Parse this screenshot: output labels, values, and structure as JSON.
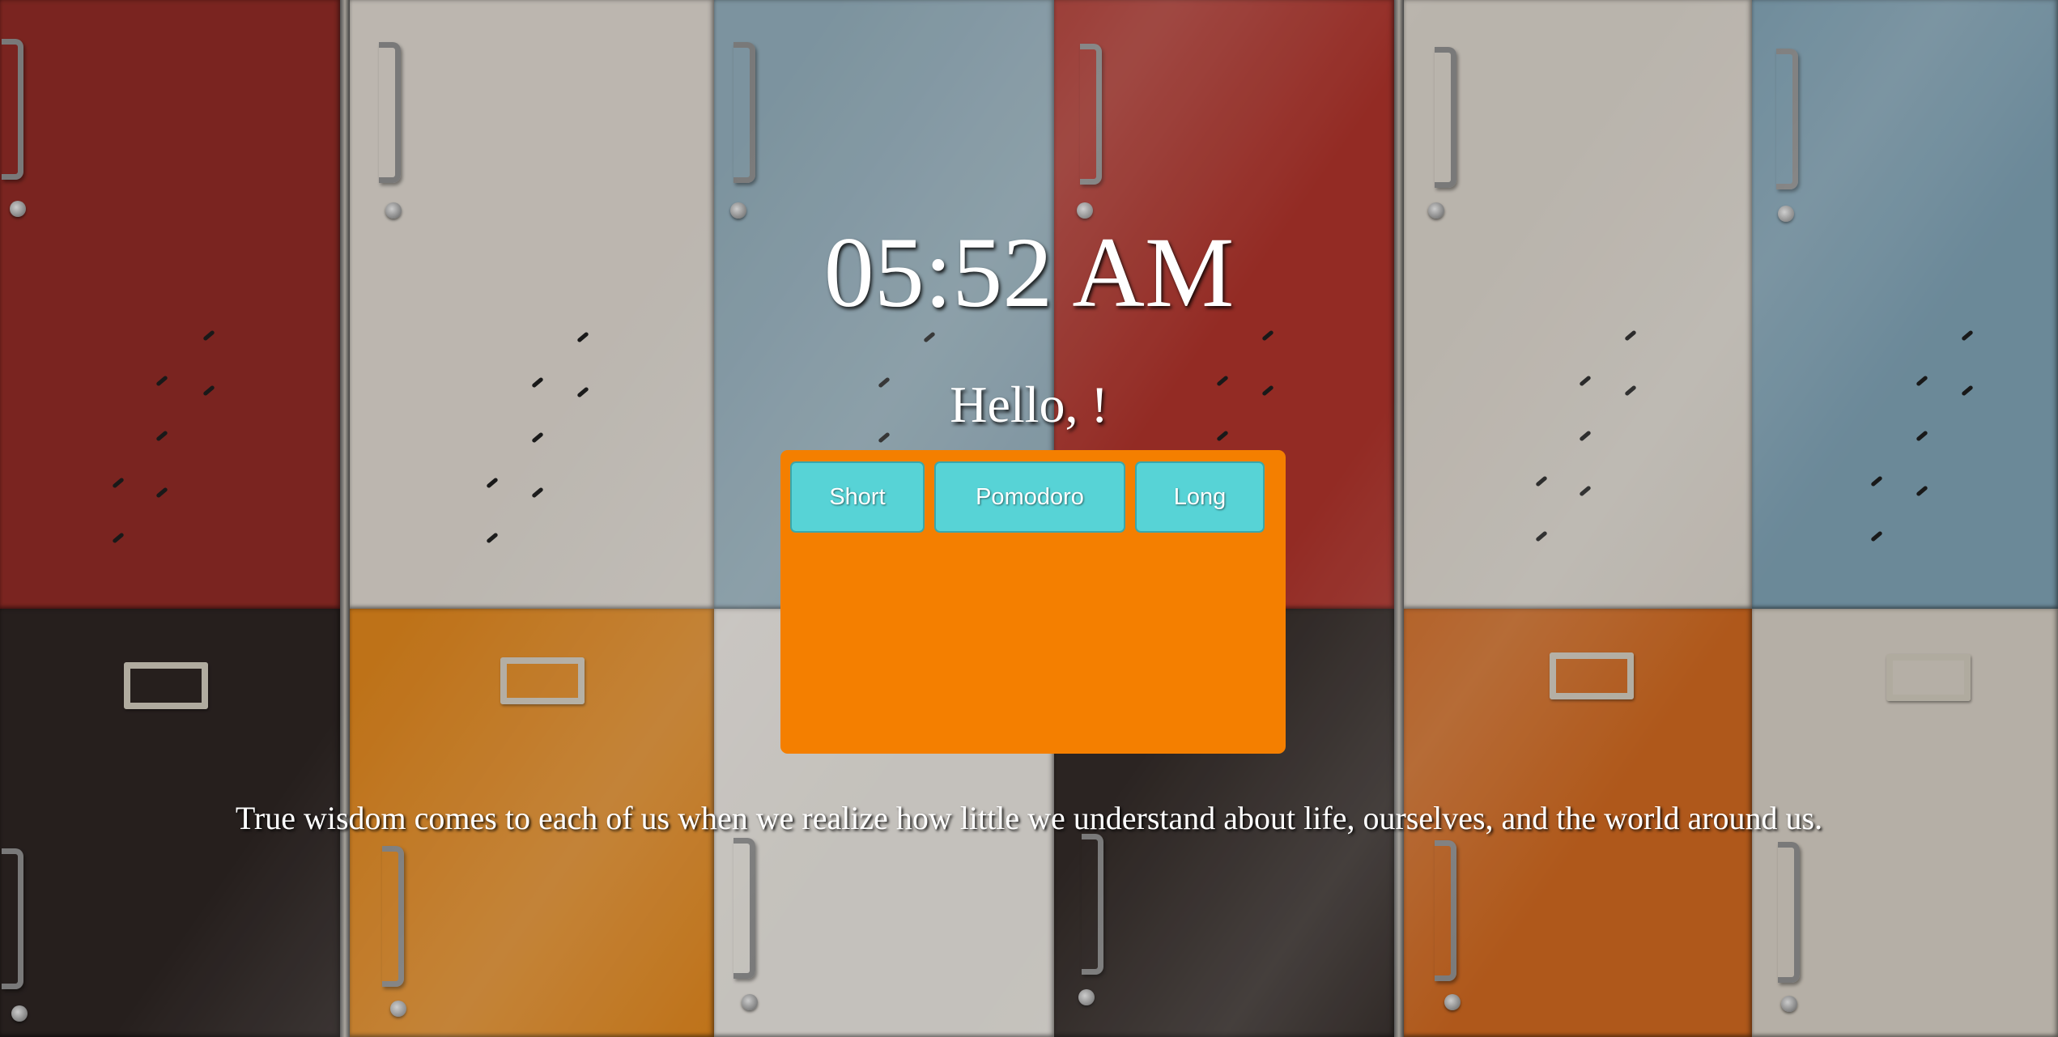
{
  "clock": {
    "time": "05:52 AM"
  },
  "greeting": {
    "text": "Hello, !"
  },
  "timer": {
    "panel_color": "#f47f00",
    "button_color": "#57d3d6",
    "modes": [
      {
        "label": "Short"
      },
      {
        "label": "Pomodoro"
      },
      {
        "label": "Long"
      }
    ]
  },
  "quote": {
    "text": "True wisdom comes to each of us when we realize how little we understand about life, ourselves, and the world around us."
  },
  "background": {
    "subject": "colorful lockers photo",
    "colors": [
      "#8b2a25",
      "#d6d0c8",
      "#8ea8b5",
      "#a8322a",
      "#d3cdc4",
      "#7a9cae",
      "#2c2422",
      "#d9821c",
      "#d88a1a",
      "#e0dcd6",
      "#322a27",
      "#c8651f",
      "#cfc8bd"
    ]
  }
}
